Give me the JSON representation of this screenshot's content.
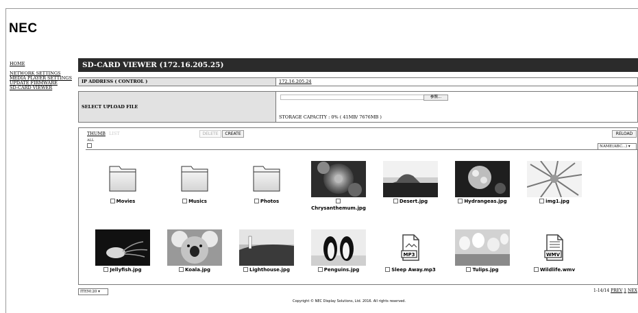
{
  "brand": {
    "logo": "NEC"
  },
  "nav": {
    "home": "HOME",
    "items": [
      "NETWORK SETTINGS",
      "MEDIA PLAYER SETTINGS",
      "UPDATE FIRMWARE",
      "SD-CARD VIEWER"
    ]
  },
  "header": {
    "title": "SD-CARD VIEWER (172.16.205.25)"
  },
  "ip_row": {
    "label": "IP ADDRESS ( CONTROL )",
    "value": "172.16.205.24"
  },
  "upload_row": {
    "label": "SELECT UPLOAD FILE",
    "browse_label": "参照...",
    "storage": "STORAGE CAPACITY : 0% ( 41MB/ 7676MB )"
  },
  "toolbar": {
    "thumb_tab": "THUMB",
    "list_tab": "LIST",
    "all_label": "ALL",
    "delete_label": "DELETE",
    "create_label": "CREATE",
    "reload_label": "RELOAD",
    "sort_value": "NAME(ABC...) ▾"
  },
  "files": [
    {
      "name": "Movies",
      "icon": "folder-icon"
    },
    {
      "name": "Musics",
      "icon": "folder-icon"
    },
    {
      "name": "Photos",
      "icon": "folder-icon"
    },
    {
      "name": "Chrysanthemum.jpg",
      "icon": "image-thumbnail"
    },
    {
      "name": "Desert.jpg",
      "icon": "image-thumbnail"
    },
    {
      "name": "Hydrangeas.jpg",
      "icon": "image-thumbnail"
    },
    {
      "name": "img1.jpg",
      "icon": "image-thumbnail"
    },
    {
      "name": "Jellyfish.jpg",
      "icon": "image-thumbnail"
    },
    {
      "name": "Koala.jpg",
      "icon": "image-thumbnail"
    },
    {
      "name": "Lighthouse.jpg",
      "icon": "image-thumbnail"
    },
    {
      "name": "Penguins.jpg",
      "icon": "image-thumbnail"
    },
    {
      "name": "Sleep Away.mp3",
      "icon": "mp3-file-icon",
      "badge": "MP3"
    },
    {
      "name": "Tulips.jpg",
      "icon": "image-thumbnail"
    },
    {
      "name": "Wildlife.wmv",
      "icon": "wmv-file-icon",
      "badge": "WMV"
    }
  ],
  "footer": {
    "items_per_page": "ITEM:20 ▾",
    "range": "1-14/14",
    "prev": "PREV",
    "page": "1",
    "next": "NEX",
    "copyright": "Copyright © NEC Display Solutions, Ltd. 2016. All rights reserved."
  }
}
